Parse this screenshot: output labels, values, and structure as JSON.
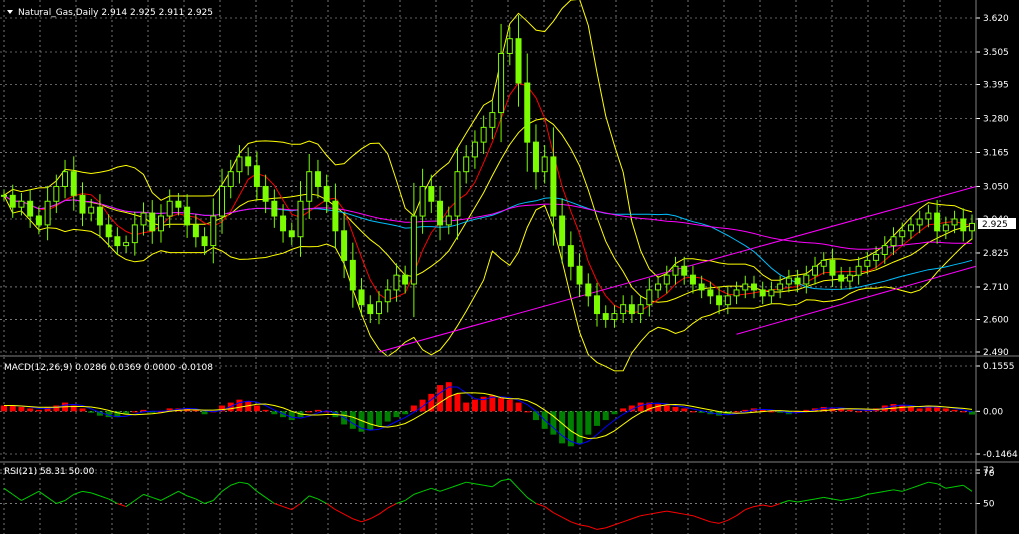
{
  "colors": {
    "background": "#000000",
    "grid": "#c0c0c0",
    "text": "#ffffff",
    "candle": "#7cfc00",
    "bands": "#ffff00",
    "trendlines": "#ff00ff",
    "ma_fast": "#ff0000",
    "ma_slow": "#00bfff",
    "ma_long": "#ff00ff",
    "macd_up": "#ff0000",
    "macd_down": "#008000",
    "macd_line": "#ffff00",
    "signal_line": "#0000ff",
    "rsi_up": "#00cc00",
    "rsi_down": "#ff0000",
    "price_tag_bg": "#ffffff",
    "price_tag_text": "#000000"
  },
  "main": {
    "header": "Natural_Gas,Daily  2.914 2.925 2.911 2.925",
    "dropdown_icon": "triangle-down-icon",
    "price_tag": "2.925",
    "yticks": [
      "3.620",
      "3.505",
      "3.395",
      "3.280",
      "3.165",
      "3.050",
      "2.940",
      "2.825",
      "2.710",
      "2.600",
      "2.490"
    ]
  },
  "macd": {
    "header": "MACD(12,26,9) 0.0286 0.0369 0.0000 -0.0108",
    "yticks": [
      "0.1555",
      "0.00",
      "-0.1464"
    ]
  },
  "rsi": {
    "header": "RSI(21) 58.31 50.00",
    "yticks": [
      "70",
      "72",
      "50"
    ]
  },
  "chart_data": [
    {
      "type": "candlestick",
      "title": "Natural_Gas,Daily",
      "ylim": [
        2.49,
        3.62
      ],
      "grid": true,
      "close": [
        3.02,
        2.98,
        3.0,
        2.95,
        2.92,
        3.0,
        3.05,
        3.1,
        3.02,
        2.96,
        2.98,
        2.92,
        2.88,
        2.85,
        2.86,
        2.92,
        2.96,
        2.9,
        2.95,
        3.0,
        2.98,
        2.92,
        2.88,
        2.85,
        2.95,
        3.05,
        3.1,
        3.15,
        3.12,
        3.05,
        3.0,
        2.95,
        2.9,
        2.88,
        3.0,
        3.1,
        3.05,
        3.0,
        2.9,
        2.8,
        2.7,
        2.65,
        2.62,
        2.66,
        2.7,
        2.75,
        2.72,
        2.95,
        3.05,
        3.0,
        2.92,
        2.95,
        3.1,
        3.15,
        3.2,
        3.25,
        3.3,
        3.5,
        3.55,
        3.4,
        3.2,
        3.1,
        3.15,
        2.95,
        2.85,
        2.78,
        2.72,
        2.68,
        2.62,
        2.6,
        2.62,
        2.65,
        2.62,
        2.65,
        2.7,
        2.72,
        2.75,
        2.78,
        2.75,
        2.72,
        2.7,
        2.68,
        2.65,
        2.68,
        2.7,
        2.72,
        2.7,
        2.68,
        2.7,
        2.72,
        2.74,
        2.72,
        2.75,
        2.78,
        2.8,
        2.75,
        2.73,
        2.75,
        2.78,
        2.8,
        2.82,
        2.85,
        2.88,
        2.9,
        2.92,
        2.94,
        2.96,
        2.9,
        2.92,
        2.94,
        2.9,
        2.925
      ]
    },
    {
      "type": "bar",
      "title": "MACD(12,26,9)",
      "ylim": [
        -0.1464,
        0.1555
      ],
      "values": [
        0.02,
        0.02,
        0.015,
        0.01,
        0.005,
        0.015,
        0.02,
        0.03,
        0.02,
        0.01,
        -0.005,
        -0.015,
        -0.02,
        -0.02,
        -0.01,
        0.0,
        0.005,
        -0.005,
        0.0,
        0.01,
        0.01,
        0.01,
        0.005,
        -0.01,
        0.0,
        0.02,
        0.03,
        0.04,
        0.035,
        0.02,
        0.005,
        -0.01,
        -0.02,
        -0.03,
        -0.02,
        0.0,
        0.005,
        0.0,
        -0.02,
        -0.045,
        -0.06,
        -0.07,
        -0.065,
        -0.05,
        -0.035,
        -0.02,
        -0.01,
        0.02,
        0.04,
        0.06,
        0.09,
        0.1,
        0.06,
        0.03,
        0.04,
        0.05,
        0.055,
        0.045,
        0.04,
        0.03,
        0.0,
        -0.03,
        -0.06,
        -0.08,
        -0.11,
        -0.12,
        -0.11,
        -0.08,
        -0.05,
        -0.03,
        -0.01,
        0.01,
        0.02,
        0.03,
        0.03,
        0.025,
        0.02,
        0.015,
        0.01,
        0.0,
        -0.005,
        -0.01,
        -0.015,
        -0.01,
        0.0,
        0.005,
        0.01,
        0.005,
        0.0,
        -0.005,
        -0.01,
        0.0,
        0.005,
        0.01,
        0.015,
        0.01,
        0.01,
        0.005,
        0.0,
        0.005,
        0.01,
        0.02,
        0.025,
        0.02,
        0.015,
        0.01,
        0.02,
        0.015,
        0.01,
        0.005,
        0.0,
        -0.011
      ]
    },
    {
      "type": "line",
      "title": "RSI(21)",
      "ylim": [
        30,
        72
      ],
      "values": [
        60,
        56,
        52,
        55,
        58,
        54,
        50,
        52,
        56,
        58,
        57,
        55,
        53,
        50,
        48,
        52,
        56,
        54,
        52,
        55,
        58,
        55,
        53,
        50,
        52,
        58,
        62,
        64,
        63,
        58,
        54,
        50,
        48,
        46,
        50,
        55,
        53,
        50,
        46,
        43,
        40,
        38,
        40,
        43,
        47,
        50,
        52,
        56,
        58,
        60,
        58,
        60,
        62,
        64,
        63,
        62,
        61,
        65,
        66,
        60,
        54,
        50,
        48,
        44,
        41,
        38,
        36,
        35,
        33,
        34,
        36,
        38,
        40,
        42,
        43,
        44,
        45,
        44,
        43,
        42,
        40,
        38,
        37,
        39,
        42,
        46,
        48,
        49,
        48,
        50,
        52,
        51,
        52,
        53,
        54,
        53,
        52,
        53,
        54,
        56,
        57,
        58,
        59,
        58,
        60,
        62,
        64,
        63,
        60,
        61,
        62,
        58
      ]
    }
  ]
}
